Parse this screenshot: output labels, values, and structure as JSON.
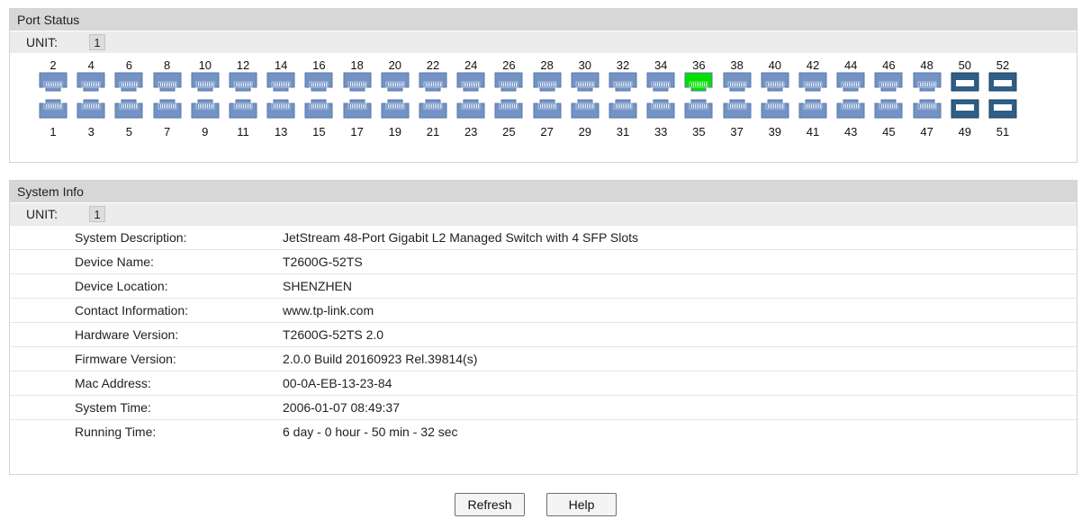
{
  "port_status": {
    "title": "Port Status",
    "unit_label": "UNIT:",
    "unit_value": "1",
    "top_numbers": [
      "2",
      "4",
      "6",
      "8",
      "10",
      "12",
      "14",
      "16",
      "18",
      "20",
      "22",
      "24",
      "26",
      "28",
      "30",
      "32",
      "34",
      "36",
      "38",
      "40",
      "42",
      "44",
      "46",
      "48",
      "50",
      "52"
    ],
    "bottom_numbers": [
      "1",
      "3",
      "5",
      "7",
      "9",
      "11",
      "13",
      "15",
      "17",
      "19",
      "21",
      "23",
      "25",
      "27",
      "29",
      "31",
      "33",
      "35",
      "37",
      "39",
      "41",
      "43",
      "45",
      "47",
      "49",
      "51"
    ],
    "active_ports": [
      "36"
    ],
    "colors": {
      "port_idle": "#7393c5",
      "port_active": "#00e000",
      "sfp": "#2f5f86"
    }
  },
  "system_info": {
    "title": "System Info",
    "unit_label": "UNIT:",
    "unit_value": "1",
    "rows": [
      {
        "label": "System Description:",
        "value": "JetStream 48-Port Gigabit L2 Managed Switch with 4 SFP Slots"
      },
      {
        "label": "Device Name:",
        "value": "T2600G-52TS"
      },
      {
        "label": "Device Location:",
        "value": "SHENZHEN"
      },
      {
        "label": "Contact Information:",
        "value": "www.tp-link.com"
      },
      {
        "label": "Hardware Version:",
        "value": "T2600G-52TS 2.0"
      },
      {
        "label": "Firmware Version:",
        "value": "2.0.0 Build 20160923 Rel.39814(s)"
      },
      {
        "label": "Mac Address:",
        "value": "00-0A-EB-13-23-84"
      },
      {
        "label": "System Time:",
        "value": "2006-01-07 08:49:37"
      },
      {
        "label": "Running Time:",
        "value": "6 day - 0 hour - 50 min - 32 sec"
      }
    ]
  },
  "buttons": {
    "refresh": "Refresh",
    "help": "Help"
  }
}
